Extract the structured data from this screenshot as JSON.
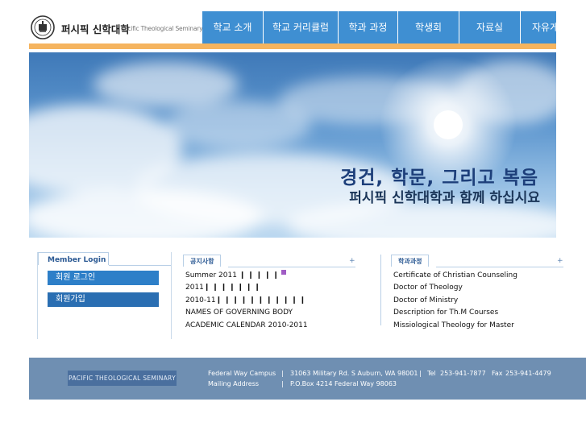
{
  "header": {
    "brand_ko": "퍼시픽 신학대학",
    "brand_en": "Pacific Theological Seminary",
    "logo_icon": "seminary-seal-icon",
    "nav": [
      {
        "label": "학교 소개"
      },
      {
        "label": "학교 커리큘럼"
      },
      {
        "label": "학과 과정"
      },
      {
        "label": "학생회"
      },
      {
        "label": "자료실"
      },
      {
        "label": "자유게시판"
      }
    ]
  },
  "banner": {
    "slogan_line1": "경건, 학문, 그리고 복음",
    "slogan_line2": "퍼시픽 신학대학과 함께 하십시요"
  },
  "login": {
    "tab": "Member Login",
    "login_button": "회원 로그인",
    "join_button": "회원가입"
  },
  "notice": {
    "tab": "공지사항",
    "more": "+",
    "items": [
      "Summer 2011 ❙ ❙ ❙ ❙ ❙",
      "2011❙ ❙ ❙ ❙ ❙ ❙ ❙",
      "2010-11❙ ❙ ❙ ❙ ❙ ❙ ❙ ❙ ❙ ❙ ❙",
      "NAMES OF GOVERNING BODY",
      "ACADEMIC CALENDAR 2010-2011"
    ]
  },
  "courses": {
    "tab": "학과과정",
    "more": "+",
    "items": [
      "Certificate of Christian Counseling",
      "Doctor of Theology",
      "Doctor of Ministry",
      "Description for Th.M Courses",
      "Missiological Theology for Master"
    ]
  },
  "footer": {
    "logo_text": "PACIFIC THEOLOGICAL SEMINARY",
    "campus_label": "Federal Way Campus",
    "campus_address": "31063 Military Rd. S Auburn, WA 98001",
    "tel_label": "Tel",
    "tel": "253-941-7877",
    "fax_label": "Fax",
    "fax": "253-941-4479",
    "mailing_label": "Mailing Address",
    "mailing_address": "P.O.Box 4214 Federal Way 98063",
    "separator": "|"
  },
  "colors": {
    "nav_blue": "#3f8fd2",
    "accent_orange": "#f5b45f",
    "footer_blue": "#6f8fb2",
    "title_blue": "#1d3f7a"
  }
}
